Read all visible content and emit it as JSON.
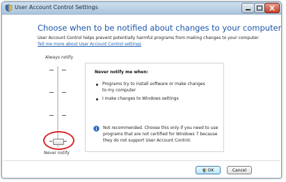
{
  "window": {
    "title": "User Account Control Settings",
    "icon": "uac-shield-icon",
    "controls": [
      "minimize-icon",
      "maximize-icon",
      "close-icon"
    ]
  },
  "main": {
    "heading": "Choose when to be notified about changes to your computer",
    "description": "User Account Control helps prevent potentially harmful programs from making changes to your computer.",
    "link": "Tell me more about User Account Control settings"
  },
  "slider": {
    "top_label": "Always notify",
    "bottom_label": "Never notify",
    "levels": 4,
    "selected_level": 1,
    "highlight_color": "#d8262c"
  },
  "info_box": {
    "title": "Never notify me when:",
    "bullets": [
      "Programs try to install software or make changes to my computer",
      "I make changes to Windows settings"
    ],
    "note": "Not recommended. Choose this only if you need to use programs that are not certified for Windows 7 because they do not support User Account Control.",
    "note_icon": "info-icon"
  },
  "buttons": {
    "ok": "OK",
    "cancel": "Cancel"
  },
  "colors": {
    "heading": "#1c56a8",
    "link": "#1a5fb4"
  }
}
